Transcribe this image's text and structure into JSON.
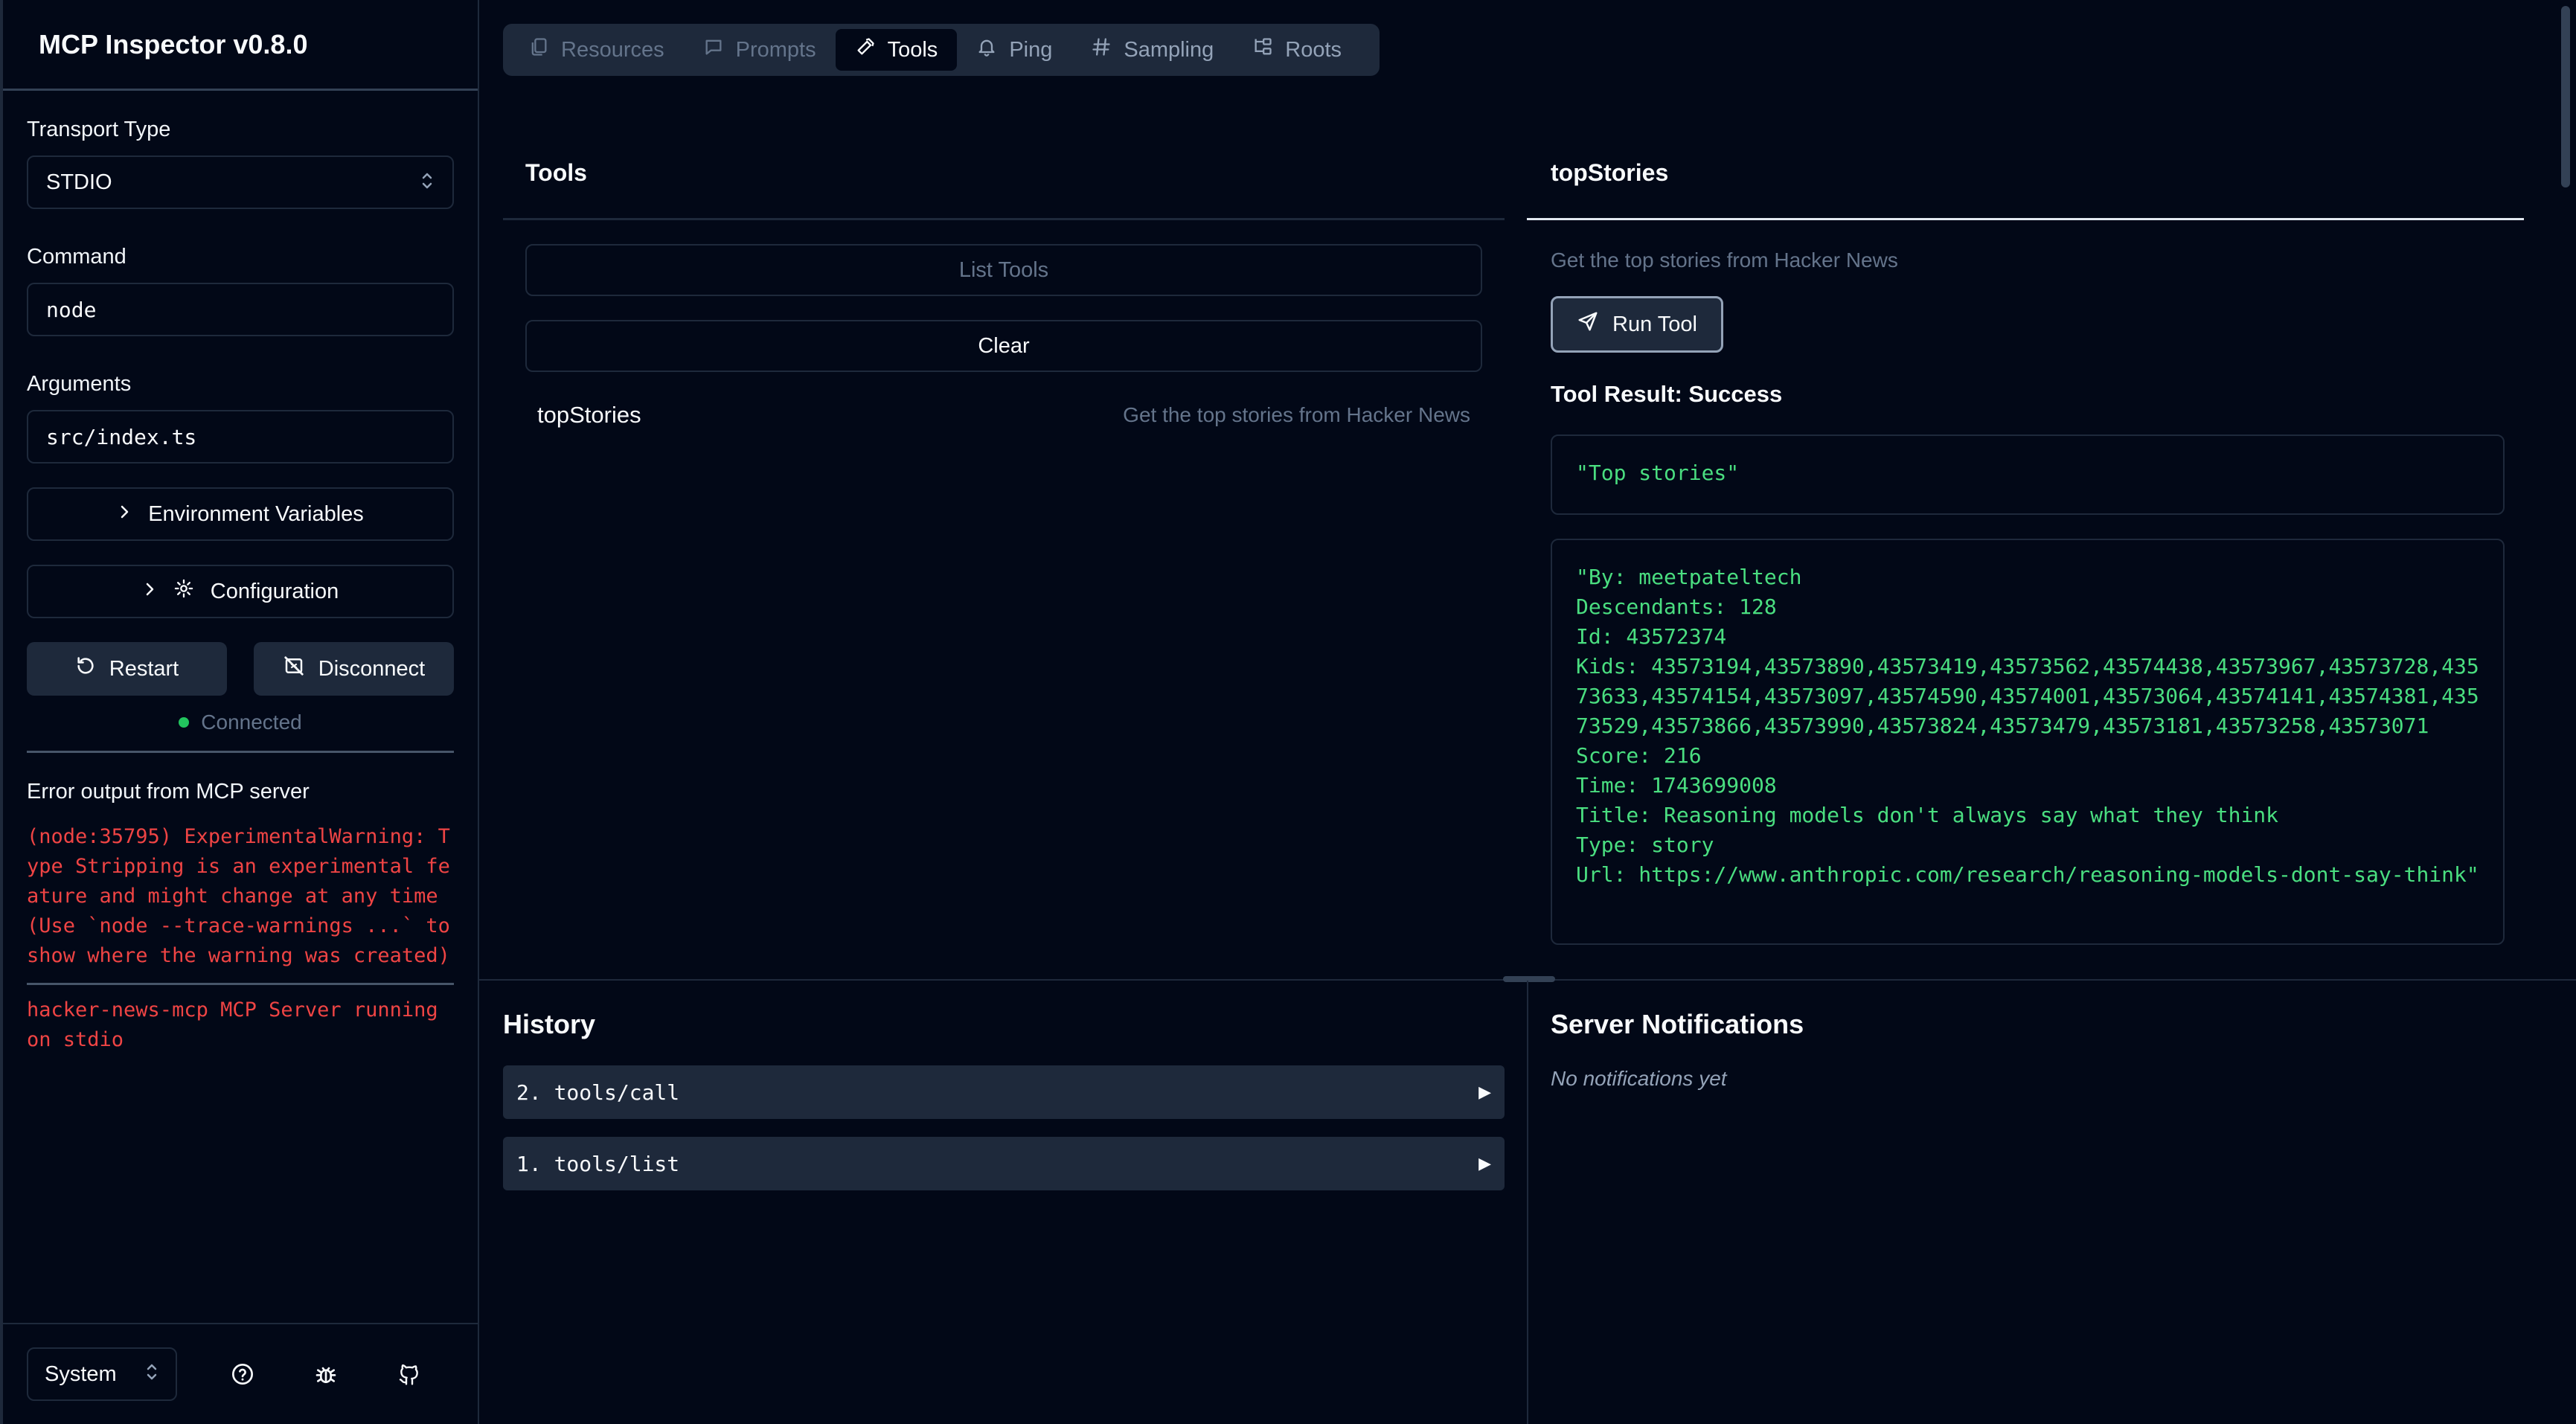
{
  "app": {
    "title": "MCP Inspector v0.8.0"
  },
  "sidebar": {
    "transport_label": "Transport Type",
    "transport_value": "STDIO",
    "command_label": "Command",
    "command_value": "node",
    "arguments_label": "Arguments",
    "arguments_value": "src/index.ts",
    "env_button": "Environment Variables",
    "config_button": "Configuration",
    "restart_button": "Restart",
    "disconnect_button": "Disconnect",
    "status": "Connected",
    "status_color": "#22c55e",
    "error_title": "Error output from MCP server",
    "error_lines": [
      "(node:35795) ExperimentalWarning: Type Stripping is an experimental feature and might change at any time (Use `node --trace-warnings ...` to show where the warning was created)",
      "hacker-news-mcp MCP Server running on stdio"
    ],
    "theme_value": "System",
    "footer_icons": [
      "help-icon",
      "bug-icon",
      "github-icon"
    ]
  },
  "tabs": [
    {
      "label": "Resources",
      "icon": "files-icon",
      "active": false
    },
    {
      "label": "Prompts",
      "icon": "message-icon",
      "active": false
    },
    {
      "label": "Tools",
      "icon": "hammer-icon",
      "active": true
    },
    {
      "label": "Ping",
      "icon": "bell-icon",
      "active": false
    },
    {
      "label": "Sampling",
      "icon": "hash-icon",
      "active": false
    },
    {
      "label": "Roots",
      "icon": "folder-tree-icon",
      "active": false
    }
  ],
  "tools_pane": {
    "title": "Tools",
    "list_button": "List Tools",
    "clear_button": "Clear",
    "items": [
      {
        "name": "topStories",
        "description": "Get the top stories from Hacker News"
      }
    ]
  },
  "detail_pane": {
    "title": "topStories",
    "description": "Get the top stories from Hacker News",
    "run_button": "Run Tool",
    "result_title": "Tool Result: Success",
    "result_blocks": [
      "\"Top stories\"",
      "\"By: meetpateltech\nDescendants: 128\nId: 43572374\nKids: 43573194,43573890,43573419,43573562,43574438,43573967,43573728,43573633,43574154,43573097,43574590,43574001,43573064,43574141,43574381,43573529,43573866,43573990,43573824,43573479,43573181,43573258,43573071\nScore: 216\nTime: 1743699008\nTitle: Reasoning models don't always say what they think\nType: story\nUrl: https://www.anthropic.com/research/reasoning-models-dont-say-think\""
    ],
    "result_color": "#4ade80"
  },
  "history": {
    "title": "History",
    "items": [
      {
        "label": "2. tools/call"
      },
      {
        "label": "1. tools/list"
      }
    ]
  },
  "notifications": {
    "title": "Server Notifications",
    "empty": "No notifications yet"
  }
}
